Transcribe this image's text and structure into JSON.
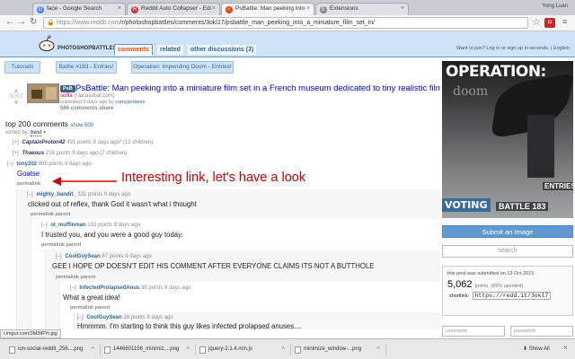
{
  "browser": {
    "tabs": [
      {
        "label": "face - Google Search",
        "favicon": "G"
      },
      {
        "label": "Reddit Auto Collapser - Edi",
        "favicon": "R"
      },
      {
        "label": "PsBattle: Man peeking into",
        "favicon": "r"
      },
      {
        "label": "Extensions",
        "favicon": "E"
      }
    ],
    "user": "Yong Luan",
    "url_host": "https://www.reddit.com",
    "url_path": "/r/photoshopbattles/comments/3okl17/psbattle_man_peeking_into_a_miniature_film_set_in/"
  },
  "header": {
    "subreddit": "PHOTOSHOPBATTLES",
    "tabs": [
      "comments",
      "related",
      "other discussions (3)"
    ],
    "login_text": "Want to join? Log in or sign up in seconds.",
    "lang": "English"
  },
  "menu_buttons": [
    "Tutorials",
    "Battle #183 - Entries!",
    "Operation: Impending Doom - Entries!"
  ],
  "post": {
    "score": "5062",
    "flair": "PsB",
    "title": "PsBattle: Man peeking into a miniature film set in a French museum dedicated to tiny realistic film",
    "domain_nsfw": "scifia",
    "domain": "(i.lacasdoal.com)",
    "submitted": "submitted 9 days ago by",
    "author": "cornyjordanm",
    "comments": "566 comments",
    "share": "share"
  },
  "comments_header": {
    "title": "top 200 comments",
    "show": "show 500",
    "sort_label": "sorted by:",
    "sort_value": "best"
  },
  "collapsed": [
    {
      "toggle": "[+]",
      "author": "CaptainProton42",
      "meta": "491 points 9 days ago* (12 children)"
    },
    {
      "toggle": "[+]",
      "author": "Thaeous",
      "meta": "218 points 9 days ago (7 children)"
    }
  ],
  "comments": [
    {
      "toggle": "[–]",
      "author": "tony202",
      "meta": "995 points 9 days ago",
      "body": "Goatse",
      "links": [
        "permalink"
      ]
    },
    {
      "toggle": "[–]",
      "author": "mighty_bandit_",
      "meta": "331 points 9 days ago",
      "body": "clicked out of reflex, thank God it wasn't what i thought",
      "links": [
        "permalink",
        "parent"
      ]
    },
    {
      "toggle": "[–]",
      "author": "ol_muffinman",
      "meta": "133 points 9 days ago",
      "body": "I trusted you, and you were a good guy today.",
      "links": [
        "permalink",
        "parent"
      ]
    },
    {
      "toggle": "[–]",
      "author": "CoolGuySean",
      "meta": "87 points 9 days ago",
      "body": "GEE I HOPE OP DOESN'T EDIT HIS COMMENT AFTER EVERYONE CLAIMS ITS NOT A BUTTHOLE",
      "links": [
        "permalink",
        "parent"
      ]
    },
    {
      "toggle": "[–]",
      "author": "InfectedProlapsedAnus",
      "meta": "38 points 9 days ago",
      "body": "What a great idea!",
      "links": [
        "permalink",
        "parent"
      ]
    },
    {
      "toggle": "[–]",
      "author": "CoolGuySean",
      "meta": "16 points 9 days ago",
      "body": "Hmmmm. I'm starting to think this guy likes infected prolapsed anuses....",
      "links": []
    }
  ],
  "annotation": "Interesting link, let's have a look",
  "sidebar": {
    "banner_title": "OPERATION:",
    "banner_sub": "doom",
    "banner_entries": "ENTRIES",
    "banner_voting": "VOTING",
    "banner_battle": "BATTLE 183",
    "submit": "Submit an Image",
    "search_placeholder": "search",
    "info_line": "this post was submitted on 13 Oct 2015",
    "points": "5,062",
    "points_label": "points",
    "upvoted": "(95% upvoted)",
    "shortlink_label": "shortlink:",
    "shortlink": "https://redd.it/3okl7",
    "username": "username",
    "password": "password"
  },
  "status_url": "i.imgur.com/3M3tRYt.jpg",
  "downloads": [
    "ion-social-reddit_256....png",
    "1446601156_minimiz....png",
    "jquery-2.1.4.min.js",
    "minimize_window-...png"
  ],
  "show_all": "Show All"
}
